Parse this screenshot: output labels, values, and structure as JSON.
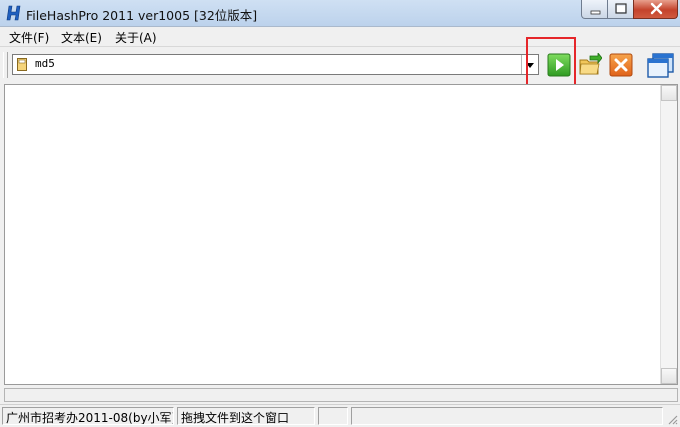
{
  "window": {
    "title": "FileHashPro 2011  ver1005 [32位版本]",
    "app_icon": "filehashpro-h-icon",
    "controls": [
      "minimize-icon",
      "maximize-icon",
      "close-icon"
    ]
  },
  "menu": {
    "items": [
      {
        "label": "文件(F)"
      },
      {
        "label": "文本(E)"
      },
      {
        "label": "关于(A)"
      }
    ]
  },
  "toolbar": {
    "algorithm_select": {
      "value": "md5",
      "icon": "file-icon"
    },
    "buttons": [
      {
        "name": "start-button",
        "icon": "green-play-icon"
      },
      {
        "name": "export-button",
        "icon": "folder-arrow-icon"
      },
      {
        "name": "stop-button",
        "icon": "orange-x-icon"
      },
      {
        "name": "window-button",
        "icon": "windows-stack-icon"
      }
    ],
    "highlight_color": "#e5262a"
  },
  "main": {
    "content": ""
  },
  "status": {
    "panels": [
      {
        "text": "广州市招考办2011-08(by小军)"
      },
      {
        "text": "拖拽文件到这个窗口"
      },
      {
        "text": ""
      },
      {
        "text": ""
      }
    ]
  }
}
